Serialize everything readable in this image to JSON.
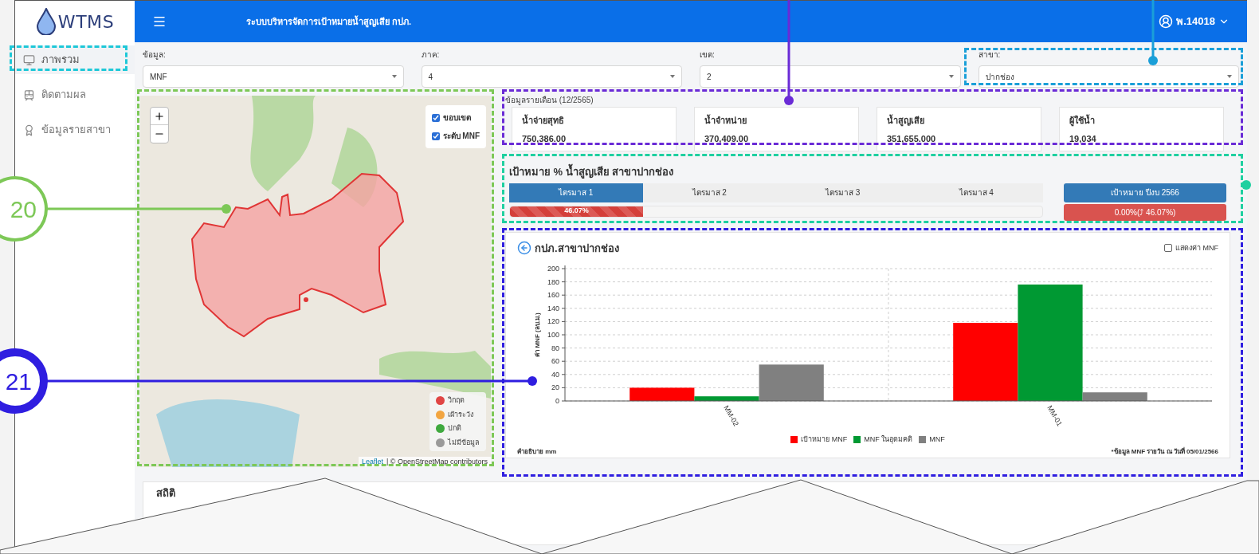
{
  "callouts": [
    {
      "label": "20",
      "color": "#7dc857"
    },
    {
      "label": "21",
      "color": "#2f1ee0"
    }
  ],
  "logo": "WTMS",
  "header": {
    "title": "ระบบบริหารจัดการเป้าหมายน้ำสูญเสีย กปภ.",
    "user": "พ.14018"
  },
  "sidebar": {
    "items": [
      {
        "label": "ภาพรวม",
        "selected": true
      },
      {
        "label": "ติดตามผล",
        "selected": false
      },
      {
        "label": "ข้อมูลรายสาขา",
        "selected": false
      }
    ]
  },
  "filters": [
    {
      "label": "ข้อมูล:",
      "value": "MNF"
    },
    {
      "label": "ภาค:",
      "value": "4"
    },
    {
      "label": "เขต:",
      "value": "2"
    },
    {
      "label": "สาขา:",
      "value": "ปากช่อง"
    }
  ],
  "map": {
    "layers": [
      {
        "label": "ขอบเขต",
        "checked": true
      },
      {
        "label": "ระดับ MNF",
        "checked": true
      }
    ],
    "legend": [
      {
        "label": "วิกฤต",
        "color": "#e04545"
      },
      {
        "label": "เฝ้าระวัง",
        "color": "#f2a541"
      },
      {
        "label": "ปกติ",
        "color": "#3fa93f"
      },
      {
        "label": "ไม่มีข้อมูล",
        "color": "#9a9a9a"
      }
    ],
    "attribution_link": "Leaflet",
    "attribution": "| © OpenStreetMap contributors"
  },
  "monthly": {
    "title": "ข้อมูลรายเดือน (12/2565)",
    "cards": [
      {
        "label": "น้ำจ่ายสุทธิ",
        "value": "750,386.00"
      },
      {
        "label": "น้ำจำหน่าย",
        "value": "370,409.00"
      },
      {
        "label": "น้ำสูญเสีย",
        "value": "351,655.000"
      },
      {
        "label": "ผู้ใช้น้ำ",
        "value": "19,034"
      }
    ]
  },
  "target": {
    "title": "เป้าหมาย % น้ำสูญเสีย สาขาปากช่อง",
    "tabs": [
      {
        "label": "ไตรมาส 1",
        "selected": true
      },
      {
        "label": "ไตรมาส 2",
        "selected": false
      },
      {
        "label": "ไตรมาส 3",
        "selected": false
      },
      {
        "label": "ไตรมาส 4",
        "selected": false
      }
    ],
    "progress": {
      "level": 0.25,
      "label": "46.07%"
    },
    "year_button": "เป้าหมาย ปีงบ 2566",
    "year_result": "0.00%(⤴ 46.07%)"
  },
  "chart_panel": {
    "title": "กปภ.สาขาปากช่อง",
    "toggle": {
      "label": "แสดงค่า MNF",
      "checked": false
    },
    "chart_data": {
      "type": "bar",
      "grid": true,
      "ylabel": "ค่า MNF (ลบ.ม.)",
      "categories": [
        "MM-02",
        "MM-01"
      ],
      "series": [
        {
          "name": "เป้าหมาย MNF",
          "color": "#ff0000",
          "values": [
            20,
            118
          ]
        },
        {
          "name": "MNF ในอุดมคติ",
          "color": "#009933",
          "values": [
            7,
            176
          ]
        },
        {
          "name": "MNF",
          "color": "#808080",
          "values": [
            55,
            13
          ]
        }
      ],
      "ylim": [
        0,
        200
      ],
      "yticks": [
        0,
        20,
        40,
        60,
        80,
        100,
        120,
        140,
        160,
        180,
        200
      ]
    },
    "note_left": "คำอธิบาย mm",
    "note_right": "*ข้อมูล MNF รายวัน ณ วันที่ 05/01/2566"
  },
  "bottom_card": {
    "title": "สถิติ"
  }
}
